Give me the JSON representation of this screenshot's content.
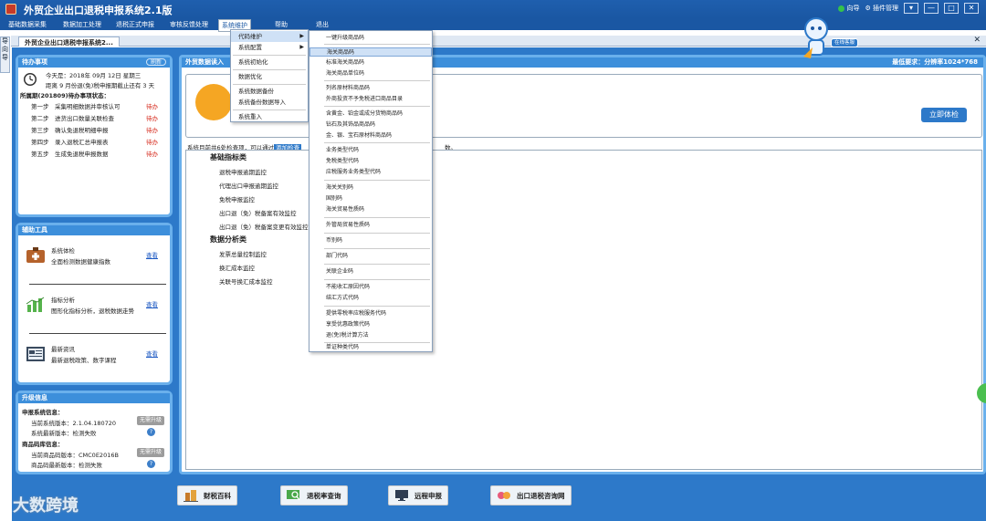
{
  "window": {
    "title": "外贸企业出口退税申报系统2.1版",
    "guide_label": "向导",
    "plugin_label": "插件管理",
    "controls": [
      "▾",
      "—",
      "□",
      "✕"
    ]
  },
  "menubar": {
    "items": [
      "基础数据采集",
      "数据加工处理",
      "退税正式申报",
      "审核反馈处理",
      "系统维护",
      "帮助",
      "退出"
    ],
    "active_index": 4
  },
  "left_strip": [
    "导",
    "向",
    "导"
  ],
  "tab": {
    "label": "外贸企业出口退税申报系统2...",
    "close": "✕"
  },
  "todo": {
    "header": "待办事项",
    "refresh_label": "刷新",
    "date_line": "今天是：2018年 09月 12日 星期三",
    "deadline_line": "距离 9 月份退(免)税申报期截止还有 3 天",
    "period_line": "所属期(201809)待办事项状态：",
    "steps": [
      {
        "step": "第一步",
        "task": "采集明细数据并审核认可",
        "status": "待办"
      },
      {
        "step": "第二步",
        "task": "进货出口数量关联检查",
        "status": "待办"
      },
      {
        "step": "第三步",
        "task": "确认免退税明细申报",
        "status": "待办"
      },
      {
        "step": "第四步",
        "task": "录入退税汇总申报表",
        "status": "待办"
      },
      {
        "step": "第五步",
        "task": "生成免退税申报数据",
        "status": "待办"
      }
    ]
  },
  "tools": {
    "header": "辅助工具",
    "items": [
      {
        "name": "系统体检",
        "desc": "全面检测数据健康指数",
        "link": "查看"
      },
      {
        "name": "指标分析",
        "desc": "图形化指标分析，退税数据走势",
        "link": "查看"
      },
      {
        "name": "最新资讯",
        "desc": "最新退税政策、数字课程",
        "link": "查看"
      }
    ]
  },
  "upgrade": {
    "header": "升级信息",
    "sys_title": "申报系统信息：",
    "sys_current": "当前系统版本：2.1.04.180720",
    "sys_latest": "系统最新版本：检测失败",
    "code_title": "商品码库信息：",
    "code_current": "当前商品码版本：CMC0E2016B",
    "code_latest": "商品码最新版本：检测失败",
    "btn_label": "无需升级",
    "help_label": "?"
  },
  "right": {
    "header": "外贸数据读入",
    "requirement": "最低要求：分辨率1024*768",
    "check_button": "立即体检",
    "status_prefix": "系统目前共6处检查项，可以通过",
    "status_highlight": "添加检查",
    "status_suffix": "数。",
    "categories": [
      {
        "title": "基础指标类",
        "items": [
          "退税申报逾期监控",
          "代理出口申报逾期监控",
          "免税申报监控",
          "出口退（免）税备案有效监控",
          "出口退（免）税备案变更有效监控"
        ]
      },
      {
        "title": "数据分析类",
        "items": [
          "发票总量控制监控",
          "换汇成本监控",
          "关联号换汇成本监控"
        ]
      }
    ]
  },
  "bottom_buttons": [
    "财税百科",
    "退税率查询",
    "远程申报",
    "出口退税咨询网"
  ],
  "menu_level1": {
    "items": [
      "代码维护",
      "系统配置",
      "系统初始化",
      "数据优化",
      "系统数据备份",
      "系统备份数据导入",
      "系统重入"
    ],
    "highlight_index": 0,
    "submenu_indices": [
      0,
      1
    ]
  },
  "menu_level2": {
    "items": [
      "一键升级商品码",
      "海关商品码",
      "标准海关商品码",
      "海关商品单位码",
      "列名原材料商品码",
      "外商投资不予免税进口商品目录",
      "含黄金、铂金或成分货物商品码",
      "钻石及其饰品商品码",
      "金、银、宝石原材料商品码",
      "业务类型代码",
      "免税类型代码",
      "应税服务业务类型代码",
      "海关关别码",
      "国别码",
      "海关贸易性质码",
      "外管局贸易性质码",
      "币别码",
      "部门代码",
      "关联企业码",
      "不能收汇原因代码",
      "结汇方式代码",
      "提供零税率应税服务代码",
      "享受优惠政策代码",
      "退(免)税计算方法",
      "单证种类代码"
    ],
    "highlight_index": 1
  },
  "mascot_badge": "在线客服",
  "watermark": "大数跨境"
}
